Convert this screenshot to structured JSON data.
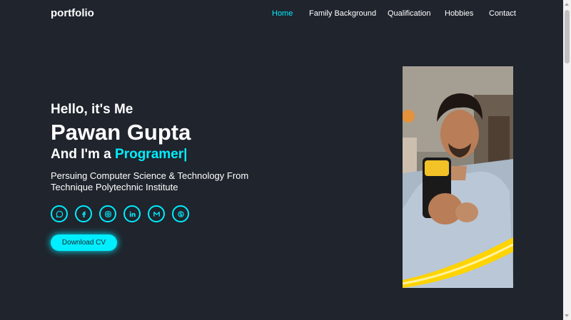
{
  "header": {
    "logo": "portfolio",
    "nav": [
      "Home",
      "Family Background",
      "Qualification",
      "Hobbies",
      "Contact"
    ],
    "active": "Home"
  },
  "hero": {
    "greeting": "Hello, it's Me",
    "name": "Pawan Gupta",
    "role_prefix": "And I'm a ",
    "role_highlight": "Programer|",
    "description": "Persuing Computer Science & Technology From Technique Polytechnic Institute",
    "social_icons": [
      "whatsapp-icon",
      "facebook-icon",
      "instagram-icon",
      "linkedin-icon",
      "gmail-icon",
      "skype-icon"
    ],
    "button": "Download CV"
  },
  "colors": {
    "background": "#1f242d",
    "accent": "#00eeff",
    "text": "#ffffff"
  }
}
